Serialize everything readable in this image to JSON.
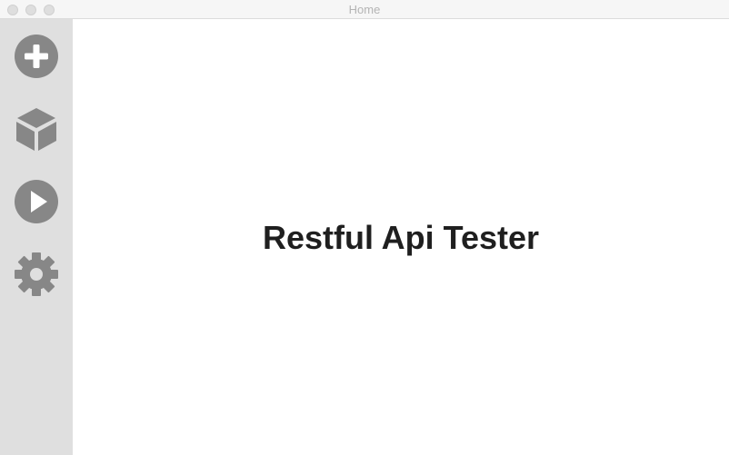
{
  "window": {
    "title": "Home"
  },
  "sidebar": {
    "items": [
      {
        "icon": "plus-circle-icon"
      },
      {
        "icon": "cube-icon"
      },
      {
        "icon": "play-circle-icon"
      },
      {
        "icon": "gear-icon"
      }
    ],
    "icon_color": "#878787",
    "background": "#dfdfdf"
  },
  "main": {
    "title": "Restful Api Tester"
  }
}
